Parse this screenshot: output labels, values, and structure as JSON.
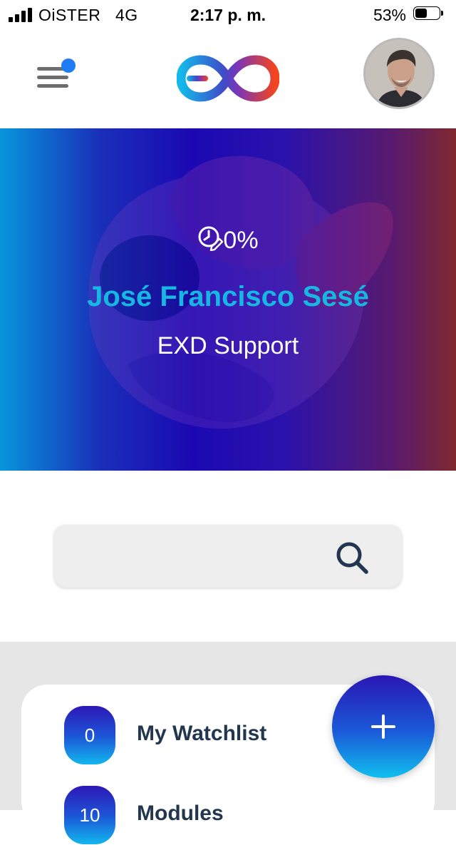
{
  "status_bar": {
    "carrier": "OiSTER",
    "network": "4G",
    "time": "2:17 p. m.",
    "battery_percent_label": "53%",
    "battery_level": 0.53
  },
  "header": {
    "menu_icon": "hamburger-menu-icon",
    "notification_dot_color": "#1f7cf2",
    "logo_icon": "exd-infinity-logo",
    "avatar_icon": "user-avatar"
  },
  "hero": {
    "progress_icon": "clock-pencil-icon",
    "progress_value": "0%",
    "user_name": "José Francisco Sesé",
    "user_role": "EXD Support",
    "name_color": "#17b7e3"
  },
  "search": {
    "value": "",
    "placeholder": "",
    "icon": "search-icon"
  },
  "list": {
    "items": [
      {
        "count": "0",
        "label": "My Watchlist"
      },
      {
        "count": "10",
        "label": "Modules"
      }
    ]
  },
  "fab": {
    "icon": "plus-icon"
  }
}
